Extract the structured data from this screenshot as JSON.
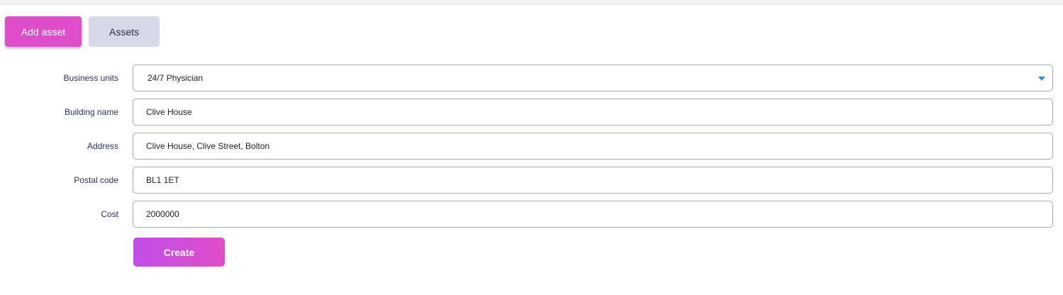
{
  "tabs": {
    "add_asset": "Add asset",
    "assets": "Assets"
  },
  "form": {
    "business_units": {
      "label": "Business units",
      "value": "24/7 Physician"
    },
    "building_name": {
      "label": "Building name",
      "value": "Clive House"
    },
    "address": {
      "label": "Address",
      "value": "Clive House, Clive Street, Bolton"
    },
    "postal_code": {
      "label": "Postal code",
      "value": "BL1 1ET"
    },
    "cost": {
      "label": "Cost",
      "value": "2000000"
    },
    "submit_label": "Create"
  },
  "colors": {
    "accent": "#e04dc8",
    "accent_gradient_start": "#c04ee8",
    "secondary_tab": "#d6d9e6",
    "label_text": "#2b3263",
    "dropdown_caret": "#2a8fe0"
  }
}
